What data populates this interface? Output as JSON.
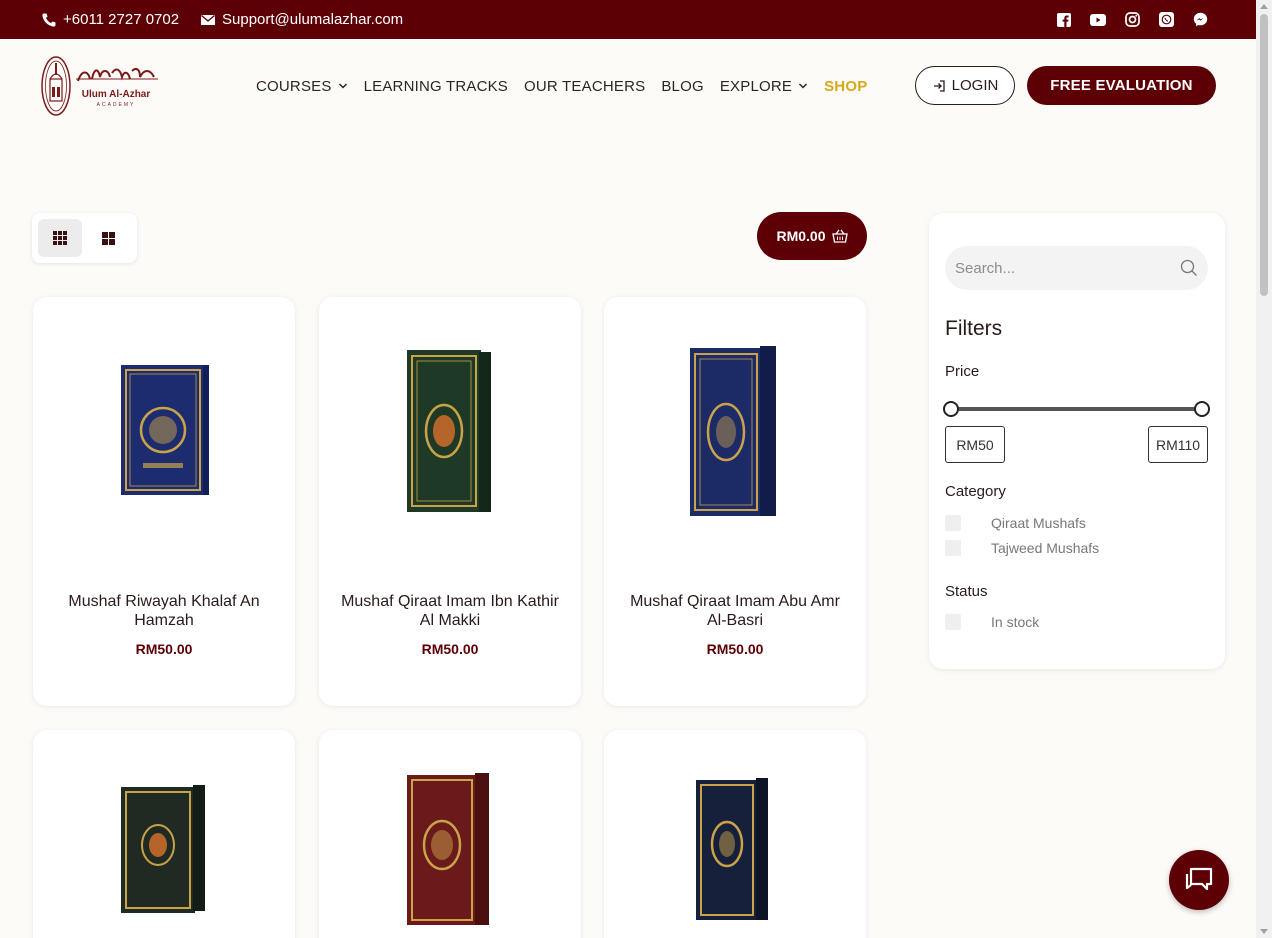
{
  "topbar": {
    "phone": "+6011 2727 0702",
    "email": "Support@ulumalazhar.com",
    "socials": [
      "facebook-icon",
      "youtube-icon",
      "instagram-icon",
      "whatsapp-icon",
      "messenger-icon"
    ]
  },
  "header": {
    "logo_text": "Ulum Al-Azhar",
    "logo_sub": "ACADEMY",
    "nav": [
      {
        "label": "COURSES",
        "dropdown": true
      },
      {
        "label": "LEARNING TRACKS",
        "dropdown": false
      },
      {
        "label": "OUR TEACHERS",
        "dropdown": false
      },
      {
        "label": "BLOG",
        "dropdown": false
      },
      {
        "label": "EXPLORE",
        "dropdown": true
      },
      {
        "label": "SHOP",
        "dropdown": false,
        "active": true
      }
    ],
    "login_label": "LOGIN",
    "cta_label": "FREE EVALUATION"
  },
  "cart": {
    "total": "RM0.00"
  },
  "products": [
    {
      "title": "Mushaf Riwayah Khalaf An Hamzah",
      "price": "RM50.00",
      "cover": "#1c2c6e"
    },
    {
      "title": "Mushaf Qiraat Imam Ibn Kathir Al Makki",
      "price": "RM50.00",
      "cover": "#1e3a26"
    },
    {
      "title": "Mushaf Qiraat Imam Abu Amr Al-Basri",
      "price": "RM50.00",
      "cover": "#1c2a66"
    },
    {
      "title": "",
      "price": "",
      "cover": "#1f2a22"
    },
    {
      "title": "",
      "price": "",
      "cover": "#6a1a1a"
    },
    {
      "title": "",
      "price": "",
      "cover": "#16203a"
    }
  ],
  "sidebar": {
    "search_placeholder": "Search...",
    "filters_heading": "Filters",
    "price_heading": "Price",
    "price_min": "RM50",
    "price_max": "RM110",
    "category_heading": "Category",
    "categories": [
      "Qiraat Mushafs",
      "Tajweed Mushafs"
    ],
    "status_heading": "Status",
    "statuses": [
      "In stock"
    ]
  },
  "colors": {
    "brand": "#5c0006",
    "accent": "#d8a81b"
  }
}
